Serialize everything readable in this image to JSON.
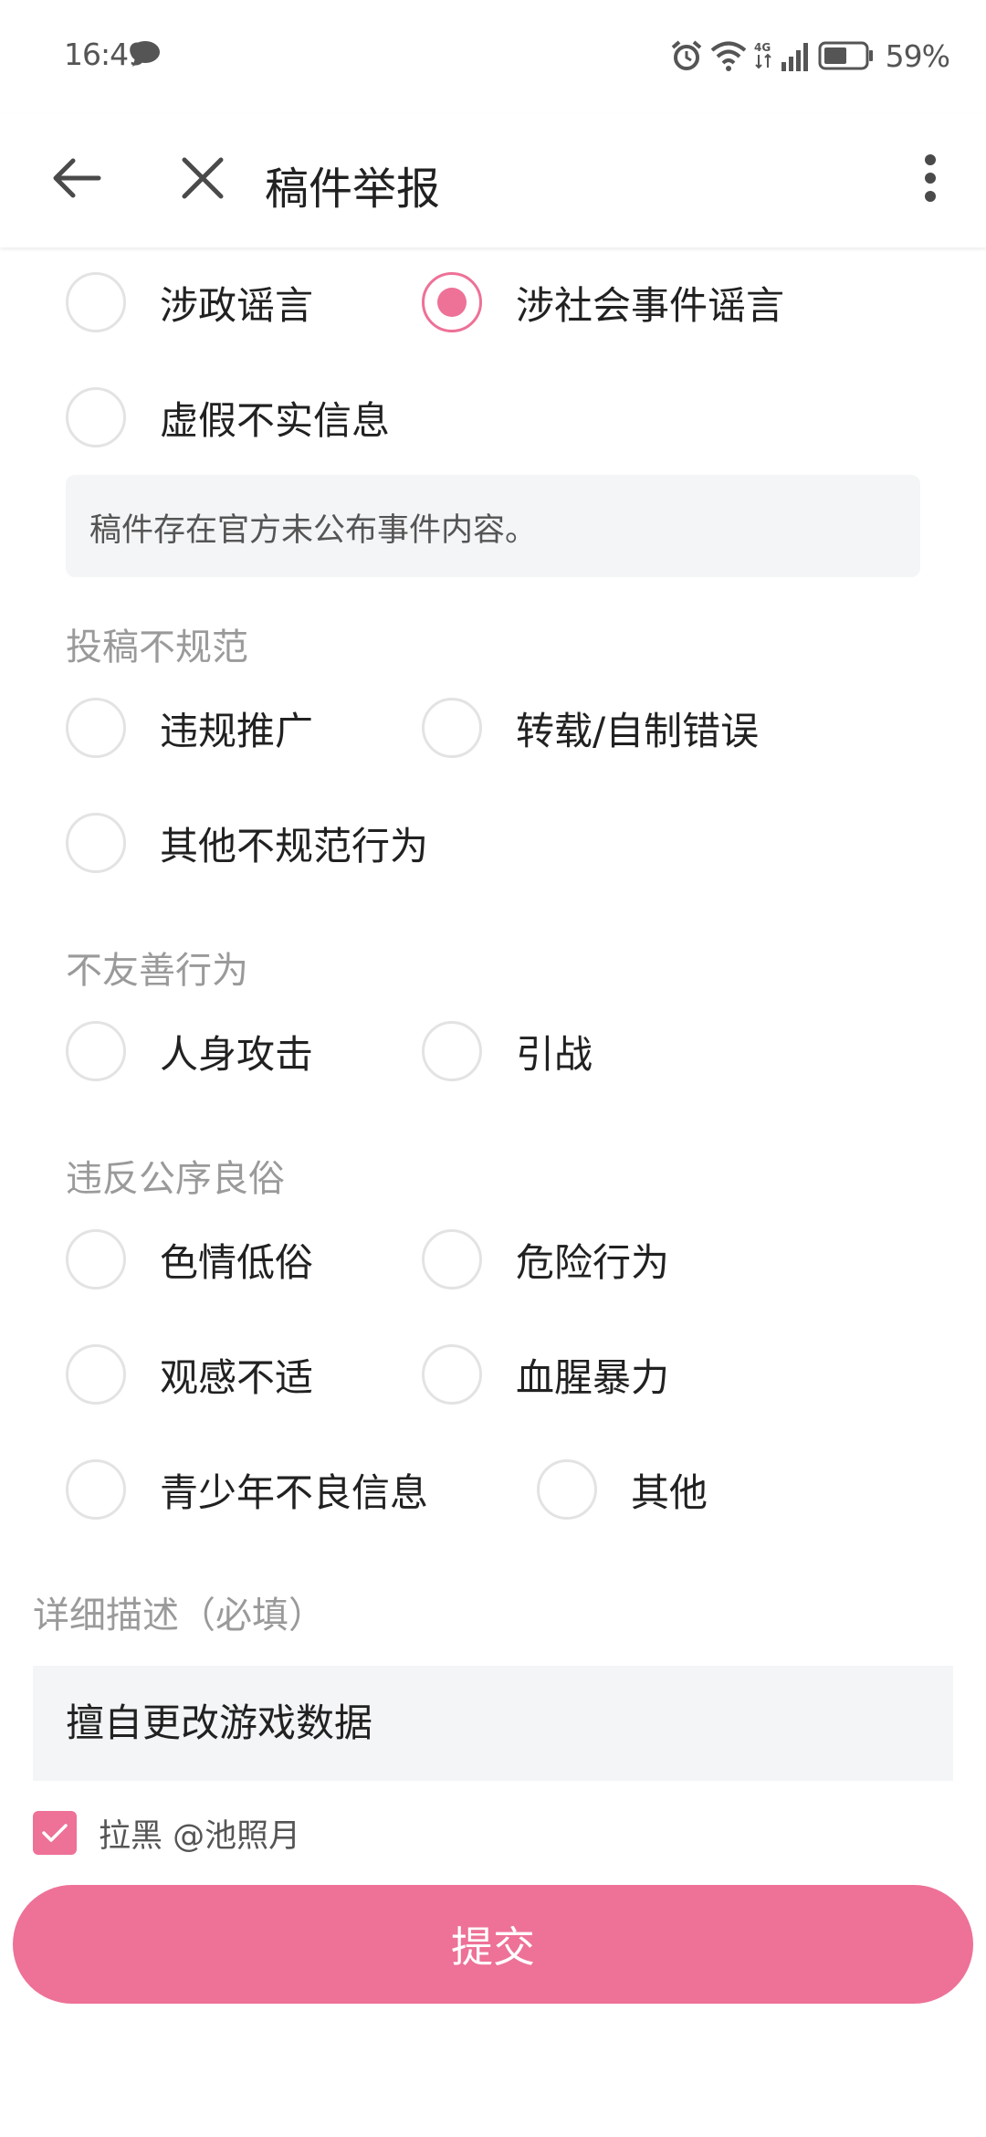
{
  "status_bar": {
    "time": "16:49",
    "battery": "59%",
    "icons": [
      "message-icon",
      "alarm-icon",
      "wifi-icon",
      "4g-icon",
      "signal-icon",
      "battery-icon"
    ]
  },
  "app_bar": {
    "title": "稿件举报",
    "icons": [
      "back-arrow-icon",
      "close-icon",
      "more-vertical-icon"
    ]
  },
  "rumor_options": [
    {
      "label": "涉政谣言",
      "checked": false
    },
    {
      "label": "涉社会事件谣言",
      "checked": true
    },
    {
      "label": "虚假不实信息",
      "checked": false
    }
  ],
  "info_box": "稿件存在官方未公布事件内容。",
  "sections": {
    "irregular": {
      "title": "投稿不规范",
      "options": [
        "违规推广",
        "转载/自制错误",
        "其他不规范行为"
      ]
    },
    "unfriendly": {
      "title": "不友善行为",
      "options": [
        "人身攻击",
        "引战"
      ]
    },
    "public_order": {
      "title": "违反公序良俗",
      "options": [
        "色情低俗",
        "危险行为",
        "观感不适",
        "血腥暴力",
        "青少年不良信息",
        "其他"
      ]
    }
  },
  "detail": {
    "title": "详细描述（必填）",
    "value": "擅自更改游戏数据"
  },
  "block": {
    "label": "拉黑 @池照月",
    "checked": true
  },
  "submit_label": "提交",
  "colors": {
    "accent": "#ee7197",
    "section_title": "#9a9a9a",
    "input_bg": "#f4f5f7",
    "radio_border": "#e3e3e3"
  }
}
